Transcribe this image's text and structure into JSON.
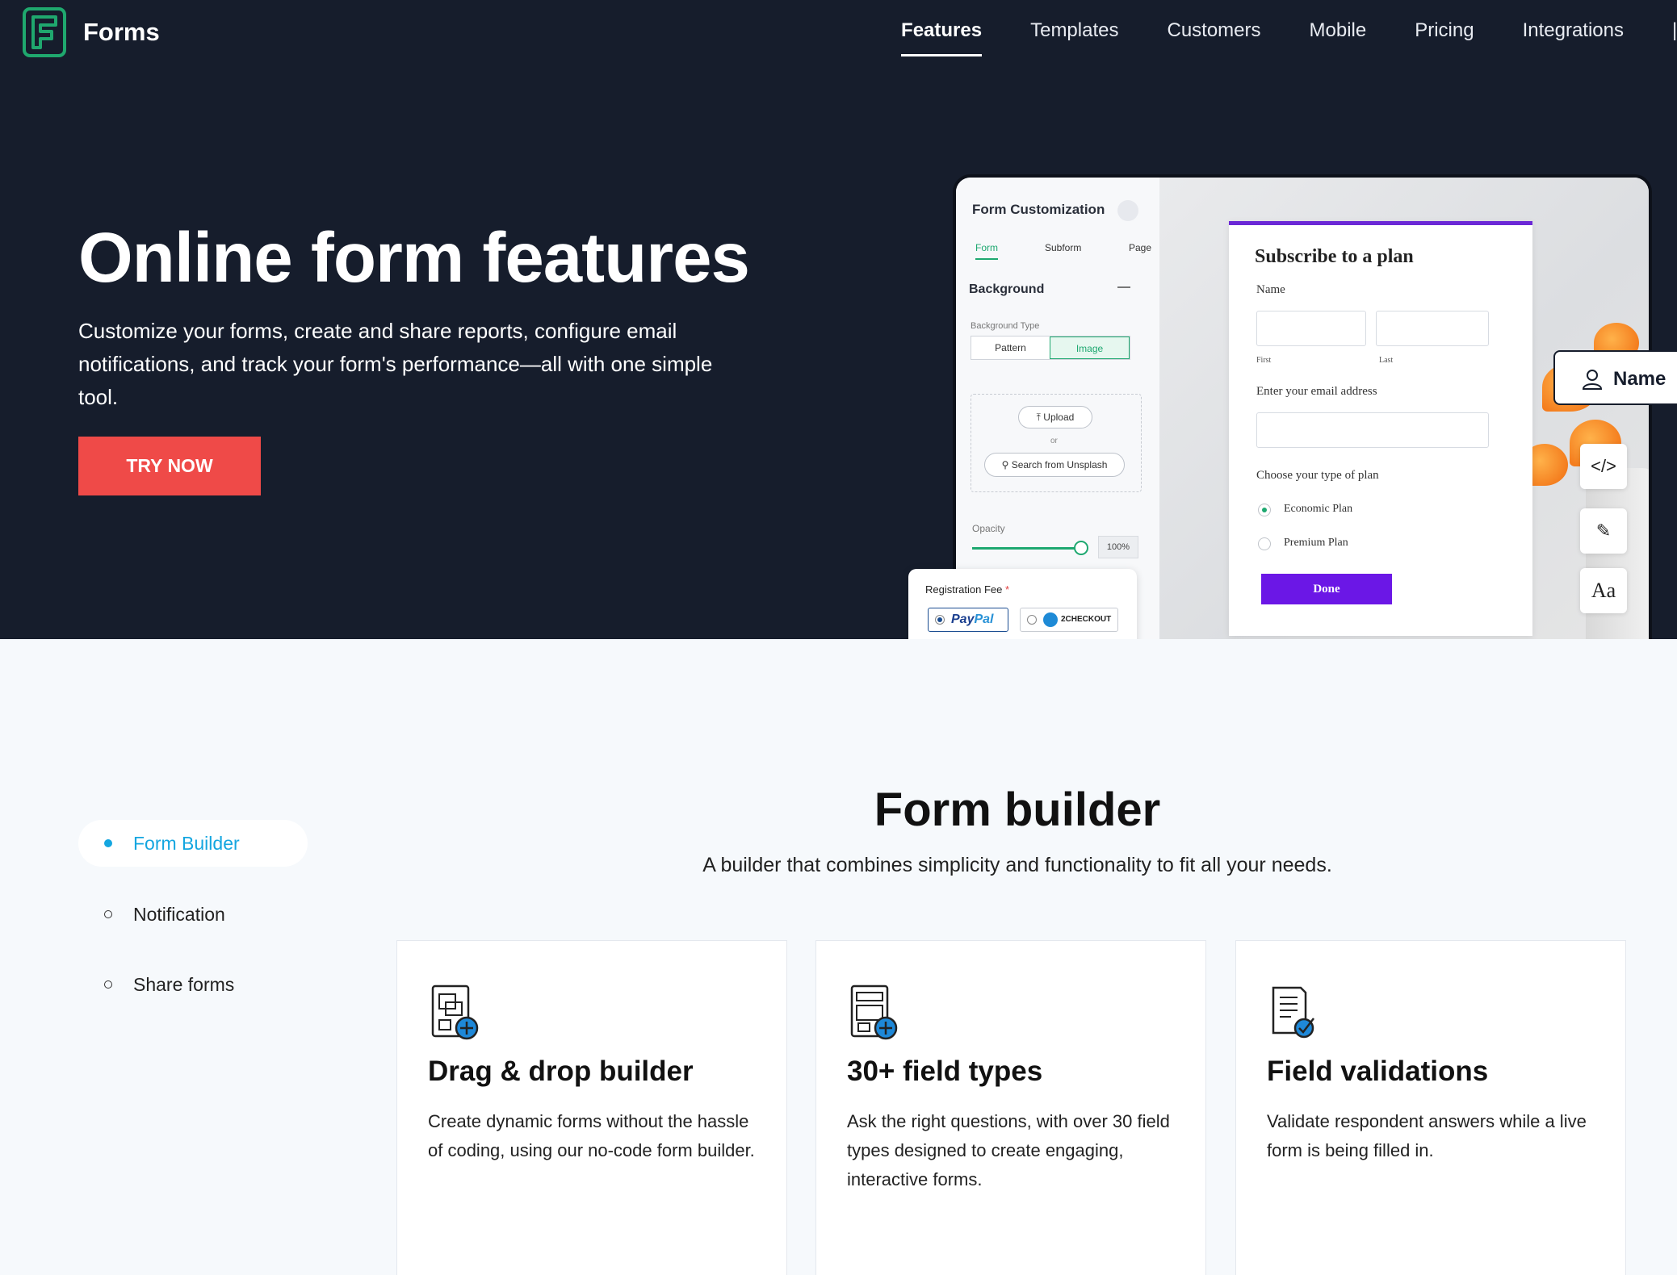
{
  "nav": {
    "brand": "Forms",
    "links": [
      {
        "label": "Features",
        "active": true
      },
      {
        "label": "Templates"
      },
      {
        "label": "Customers"
      },
      {
        "label": "Mobile"
      },
      {
        "label": "Pricing"
      },
      {
        "label": "Integrations"
      }
    ]
  },
  "hero": {
    "title": "Online form features",
    "subtitle": "Customize your forms, create and share reports, configure email notifications, and track your form's performance—all with one simple tool.",
    "cta": "TRY NOW"
  },
  "mockup": {
    "panel": {
      "title": "Form Customization",
      "tabs": [
        "Form",
        "Subform",
        "Page"
      ],
      "section": "Background",
      "bg_type_label": "Background Type",
      "bg_types": [
        "Pattern",
        "Image"
      ],
      "upload": "Upload",
      "or": "or",
      "search": "Search from Unsplash",
      "opacity_label": "Opacity",
      "opacity_value": "100%"
    },
    "form": {
      "title": "Subscribe to a plan",
      "name_label": "Name",
      "first": "First",
      "last": "Last",
      "email_label": "Enter your email address",
      "plan_label": "Choose your type of plan",
      "plans": [
        "Economic Plan",
        "Premium Plan"
      ],
      "done": "Done"
    },
    "name_chip": "Name",
    "tools": [
      "</>",
      "✎",
      "Aa"
    ],
    "registration": {
      "label": "Registration Fee",
      "required": "*",
      "paypal_a": "Pay",
      "paypal_b": "Pal",
      "checkout": "2CHECKOUT"
    }
  },
  "features": {
    "side_nav": [
      {
        "label": "Form Builder",
        "active": true
      },
      {
        "label": "Notification"
      },
      {
        "label": "Share forms"
      }
    ],
    "title": "Form builder",
    "subtitle": "A builder that combines simplicity and functionality to fit all your needs.",
    "cards": [
      {
        "icon": "drag-drop-icon",
        "title": "Drag & drop builder",
        "desc": "Create dynamic forms without the hassle of coding, using our no-code form builder."
      },
      {
        "icon": "field-types-icon",
        "title": "30+ field types",
        "desc": "Ask the right questions, with over 30 field types designed to create engaging, interactive forms."
      },
      {
        "icon": "field-validation-icon",
        "title": "Field validations",
        "desc": "Validate respondent answers while a live form is being filled in."
      }
    ]
  },
  "colors": {
    "hero_bg": "#161d2c",
    "cta": "#ef4a48",
    "accent_green": "#1ea870",
    "accent_blue": "#14a6e0",
    "form_purple": "#6b17e6"
  }
}
